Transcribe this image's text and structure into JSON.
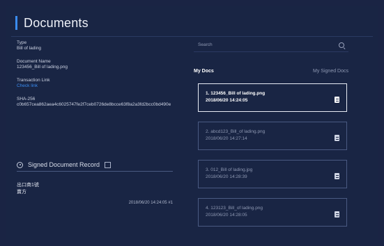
{
  "header": {
    "title": "Documents"
  },
  "details": {
    "type_label": "Type",
    "type_value": "Bill of lading",
    "docname_label": "Document Name",
    "docname_value": "123456_Bill of lading.png",
    "txlink_label": "Transaction Link",
    "txlink_value": "Check link",
    "sha_label": "SHA-256",
    "sha_value": "c0b657cea862aea4c6025747fe2f7ceb0726de8bcce63f8a2a3fd2bcc0bd490e"
  },
  "signed_record": {
    "title": "Signed Document Record",
    "entry_name": "出口商1號",
    "entry_role": "賣方",
    "entry_time": "2018/06/20 14:24:05 #1"
  },
  "search": {
    "placeholder": "Search"
  },
  "tabs": {
    "my_docs": "My Docs",
    "signed_docs": "My Signed Docs"
  },
  "docs": [
    {
      "name": "1. 123456_Bill of lading.png",
      "date": "2018/06/20 14:24:05",
      "active": true
    },
    {
      "name": "2. abcd123_Bill_of lading.png",
      "date": "2018/06/20 14:27:14",
      "active": false
    },
    {
      "name": "3. 012_Bill of lading.jpg",
      "date": "2018/06/20 14:28:39",
      "active": false
    },
    {
      "name": "4. 123123_Bill_of lading.png",
      "date": "2018/06/20 14:28:05",
      "active": false
    }
  ],
  "icons": {
    "doc": "document-icon",
    "search": "search-icon",
    "record": "record-icon"
  },
  "colors": {
    "background": "#192544",
    "accent": "#3a8cf0",
    "text": "#e6e9f2"
  }
}
